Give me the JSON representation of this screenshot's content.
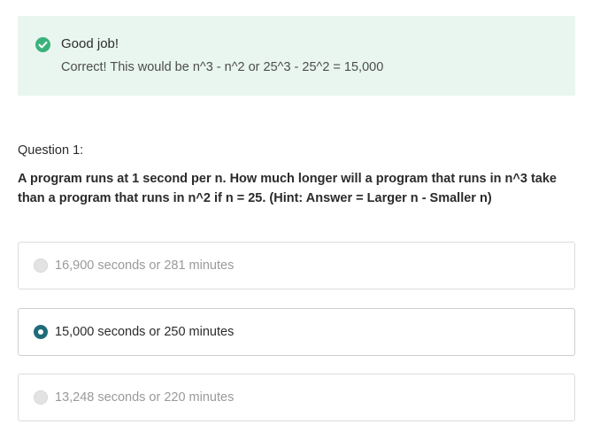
{
  "feedback": {
    "icon": "check-circle-icon",
    "icon_color": "#3bb27a",
    "background": "#e9f6f0",
    "title": "Good job!",
    "message": "Correct! This would be n^3 - n^2 or 25^3 - 25^2 = 15,000"
  },
  "question": {
    "label": "Question 1:",
    "text": "A program runs at 1 second per n. How much longer will a program that runs in n^3 take than a program that runs in n^2 if n = 25. (Hint: Answer = Larger n - Smaller n)"
  },
  "options": [
    {
      "label": "16,900 seconds or 281 minutes",
      "selected": false,
      "disabled": true
    },
    {
      "label": "15,000 seconds or 250 minutes",
      "selected": true,
      "disabled": false
    },
    {
      "label": "13,248 seconds or 220 minutes",
      "selected": false,
      "disabled": true
    }
  ],
  "colors": {
    "radio_selected": "#1f6b7a",
    "text_dim": "#9a9a9a"
  }
}
